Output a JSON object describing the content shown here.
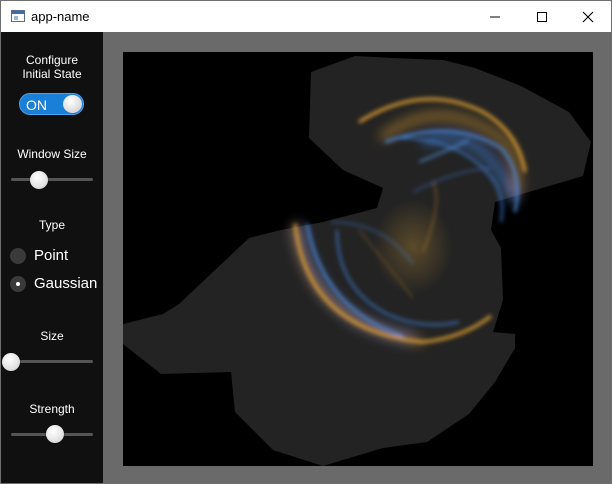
{
  "window": {
    "title": "app-name",
    "controls": {
      "minimize": "minimize-icon",
      "maximize": "maximize-icon",
      "close": "close-icon"
    }
  },
  "sidebar": {
    "configure_label": "Configure\nInitial State",
    "toggle": {
      "label": "ON",
      "state": true,
      "color": "#1a7fd6"
    },
    "window_size": {
      "label": "Window Size",
      "value": 0.35
    },
    "type": {
      "label": "Type",
      "options": [
        {
          "label": "Point",
          "selected": false
        },
        {
          "label": "Gaussian",
          "selected": true
        }
      ]
    },
    "size": {
      "label": "Size",
      "value": 0.0
    },
    "strength": {
      "label": "Strength",
      "value": 0.55
    }
  },
  "canvas": {
    "background": "#000000",
    "frame_color": "#6a6a6a",
    "region_color": "#232323",
    "glow_colors": {
      "orange": "#e0a030",
      "blue": "#3f7fd8"
    }
  }
}
